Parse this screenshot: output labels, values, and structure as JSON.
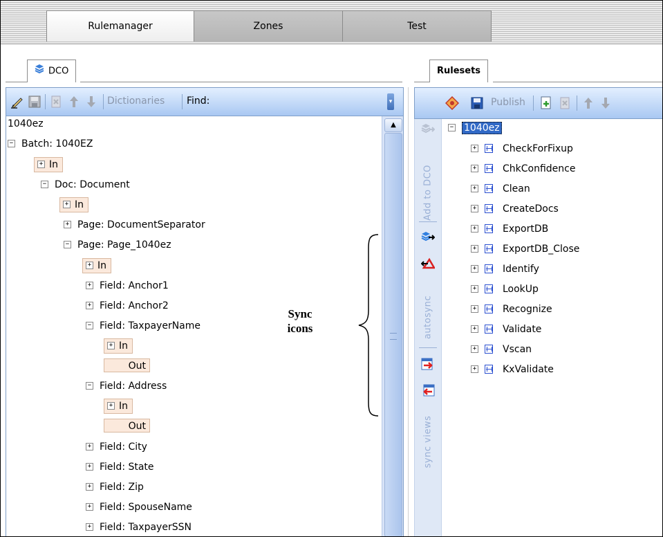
{
  "top_tabs": [
    "Rulemanager",
    "Zones",
    "Test"
  ],
  "left_panel": {
    "tab": "DCO",
    "toolbar": {
      "dictionaries": "Dictionaries",
      "find": "Find:"
    },
    "tree": [
      {
        "text": "1040ez"
      },
      {
        "text": "Batch: 1040EZ"
      },
      {
        "text": "In"
      },
      {
        "text": "Doc: Document"
      },
      {
        "text": "In"
      },
      {
        "text": "Page: DocumentSeparator"
      },
      {
        "text": "Page: Page_1040ez"
      },
      {
        "text": "In"
      },
      {
        "text": "Field: Anchor1"
      },
      {
        "text": "Field: Anchor2"
      },
      {
        "text": "Field: TaxpayerName"
      },
      {
        "text": "In"
      },
      {
        "text": "Out"
      },
      {
        "text": "Field: Address"
      },
      {
        "text": "In"
      },
      {
        "text": "Out"
      },
      {
        "text": "Field: City"
      },
      {
        "text": "Field: State"
      },
      {
        "text": "Field: Zip"
      },
      {
        "text": "Field: SpouseName"
      },
      {
        "text": "Field: TaxpayerSSN"
      }
    ]
  },
  "sync_strip": {
    "add_to_dco": "Add to DCO",
    "autosync": "autosync",
    "sync_views": "sync views"
  },
  "right_panel": {
    "tab": "Rulesets",
    "toolbar": {
      "publish": "Publish"
    },
    "root": "1040ez",
    "rulesets": [
      "CheckForFixup",
      "ChkConfidence",
      "Clean",
      "CreateDocs",
      "ExportDB",
      "ExportDB_Close",
      "Identify",
      "LookUp",
      "Recognize",
      "Validate",
      "Vscan",
      "KxValidate"
    ]
  },
  "annotation": {
    "line1": "Sync",
    "line2": "icons"
  }
}
